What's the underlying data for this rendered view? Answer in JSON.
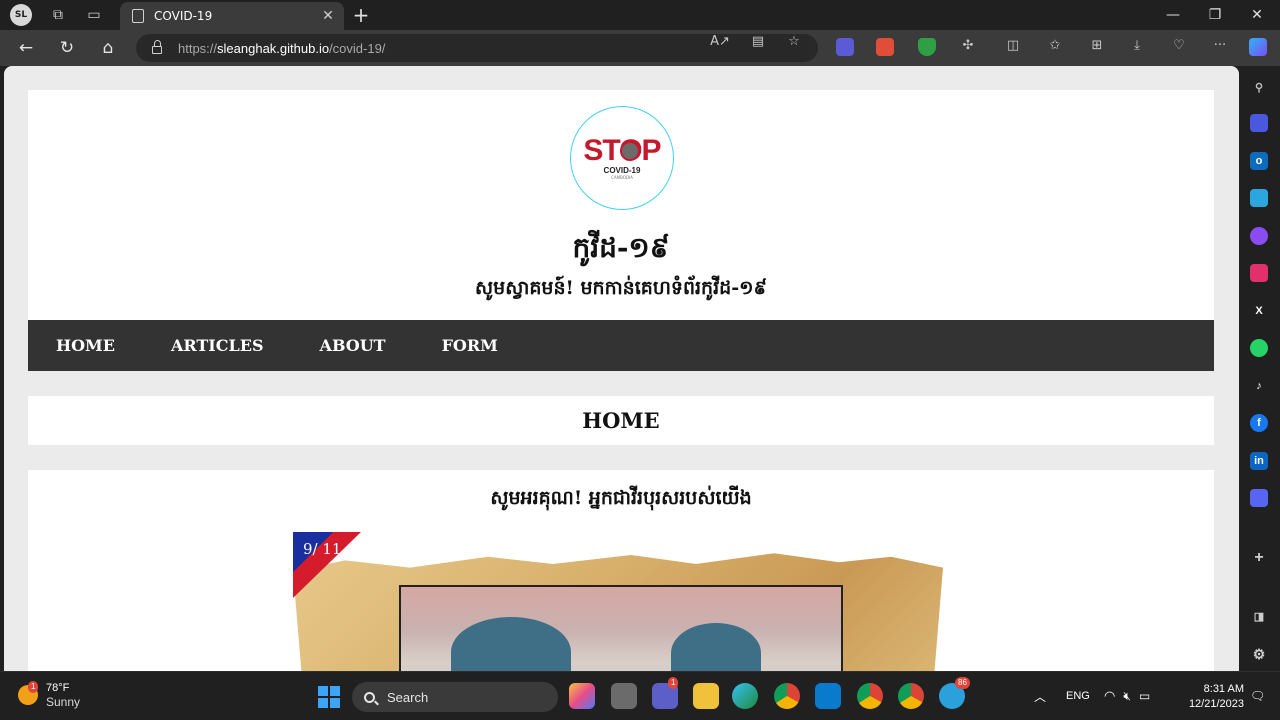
{
  "browser": {
    "profile_initials": "SL",
    "tab_title": "COVID-19",
    "url_prefix": "https://",
    "url_host": "sleanghak.github.io",
    "url_path": "/covid-19/"
  },
  "site": {
    "logo_word": "STOP",
    "logo_sub": "COVID-19",
    "logo_small": "CAMBODIA",
    "title": "កូវីដ-១៩",
    "subtitle": "សូមស្វាគមន៍! មកកាន់គេហទំព័រកូវីដ-១៩",
    "menu": [
      {
        "label": "HOME"
      },
      {
        "label": "ARTICLES"
      },
      {
        "label": "ABOUT"
      },
      {
        "label": "FORM"
      }
    ],
    "page_heading": "HOME",
    "content_heading": "សូមអរគុណ! អ្នកជាវីរបុរសរបស់យើង",
    "poster_badge": "9/ 11"
  },
  "taskbar": {
    "weather_temp": "78°F",
    "weather_cond": "Sunny",
    "weather_badge": "1",
    "search_label": "Search",
    "teams_badge": "1",
    "telegram_badge": "86",
    "language": "ENG",
    "time": "8:31 AM",
    "date": "12/21/2023"
  },
  "colors": {
    "menu_bg": "#333333",
    "logo_red": "#c4182b",
    "logo_ring": "#3fd3ee",
    "page_bg": "#ebebeb"
  }
}
